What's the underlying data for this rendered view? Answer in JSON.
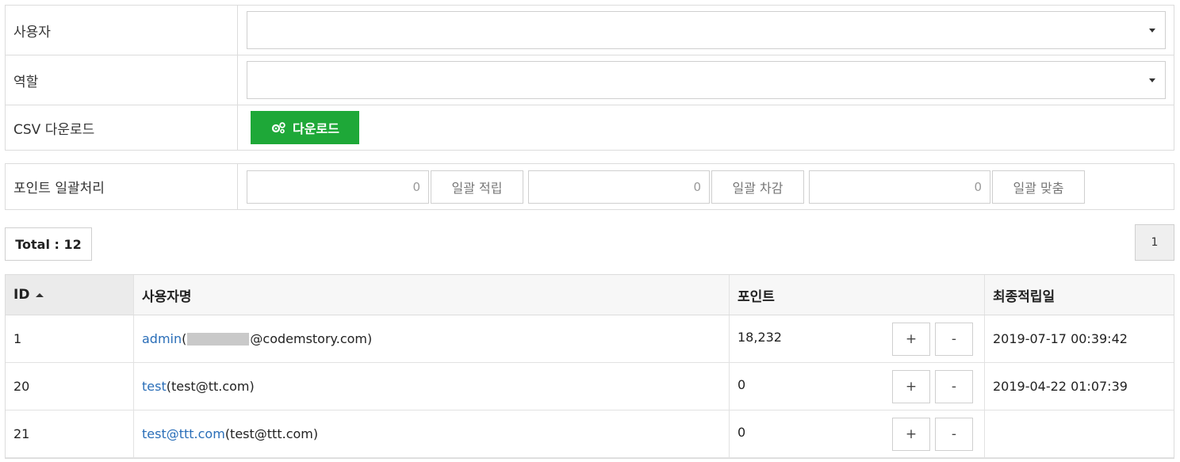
{
  "filters": {
    "user_label": "사용자",
    "role_label": "역할",
    "csv_label": "CSV 다운로드",
    "download_button": "다운로드"
  },
  "bulk": {
    "label": "포인트 일괄처리",
    "add_value": "0",
    "add_button": "일괄 적립",
    "sub_value": "0",
    "sub_button": "일괄 차감",
    "set_value": "0",
    "set_button": "일괄 맞춤"
  },
  "summary": {
    "total": "Total : 12",
    "page": "1"
  },
  "table": {
    "headers": {
      "id": "ID",
      "username": "사용자명",
      "point": "포인트",
      "last_date": "최종적립일"
    },
    "rows": [
      {
        "id": "1",
        "name": "admin",
        "email_prefix": "(",
        "email_suffix": "@codemstory.com)",
        "point": "18,232",
        "plus": "+",
        "minus": "-",
        "date": "2019-07-17 00:39:42"
      },
      {
        "id": "20",
        "name": "test",
        "email": "(test@tt.com)",
        "point": "0",
        "plus": "+",
        "minus": "-",
        "date": "2019-04-22 01:07:39"
      },
      {
        "id": "21",
        "name": "test@ttt.com",
        "email": "(test@ttt.com)",
        "point": "0",
        "plus": "+",
        "minus": "-",
        "date": ""
      }
    ]
  },
  "colors": {
    "accent_green": "#1ea838",
    "link_blue": "#2a6eb8"
  }
}
